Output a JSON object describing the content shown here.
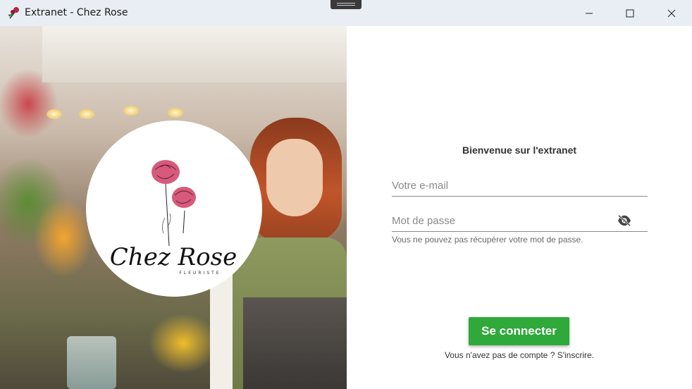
{
  "window": {
    "title": "Extranet - Chez Rose",
    "controls": {
      "minimize": "minimize-icon",
      "maximize": "maximize-icon",
      "close": "close-icon"
    }
  },
  "brand": {
    "logo_name": "Chez Rose",
    "logo_tagline": "FLEURISTE",
    "accent_rose": "#d2486e"
  },
  "login": {
    "welcome": "Bienvenue sur l'extranet",
    "email_placeholder": "Votre e-mail",
    "password_placeholder": "Mot de passe",
    "password_toggle_icon": "eye-off-icon",
    "forgot_text": "Vous ne pouvez pas récupérer votre mot de passe.",
    "submit_label": "Se connecter",
    "submit_color": "#2fa93a",
    "no_account_text": "Vous n'avez pas de compte ?",
    "signup_link": "S'inscrire."
  }
}
